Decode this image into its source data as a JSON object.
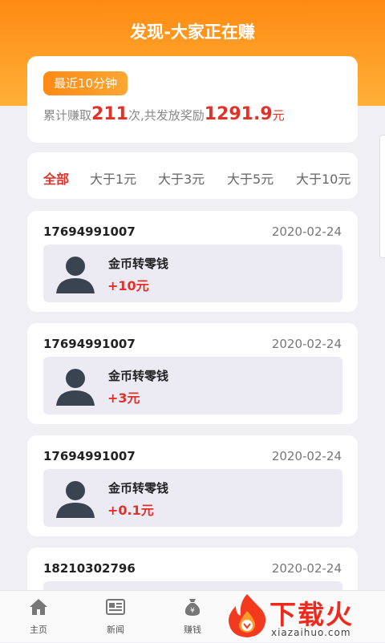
{
  "header": {
    "title": "发现-大家正在赚"
  },
  "summary": {
    "badge": "最近10分钟",
    "prefix": "累计赚取",
    "count": "211",
    "mid": "次,共发放奖励",
    "amount": "1291.9",
    "unit": "元"
  },
  "filters": [
    "全部",
    "大于1元",
    "大于3元",
    "大于5元",
    "大于10元"
  ],
  "active_filter": "全部",
  "records": [
    {
      "phone": "17694991007",
      "date": "2020-02-24",
      "desc": "金币转零钱",
      "amount": "+10元"
    },
    {
      "phone": "17694991007",
      "date": "2020-02-24",
      "desc": "金币转零钱",
      "amount": "+3元"
    },
    {
      "phone": "17694991007",
      "date": "2020-02-24",
      "desc": "金币转零钱",
      "amount": "+0.1元"
    },
    {
      "phone": "18210302796",
      "date": "2020-02-24"
    }
  ],
  "bottom_nav": [
    {
      "label": "主页",
      "icon": "home-icon"
    },
    {
      "label": "新闻",
      "icon": "news-icon"
    },
    {
      "label": "赚钱",
      "icon": "money-bag-icon"
    }
  ],
  "watermark": {
    "cn": "下载火",
    "en": "xiazaihuo.com"
  },
  "colors": {
    "accent": "#ff8a12",
    "highlight": "#e0322b"
  }
}
